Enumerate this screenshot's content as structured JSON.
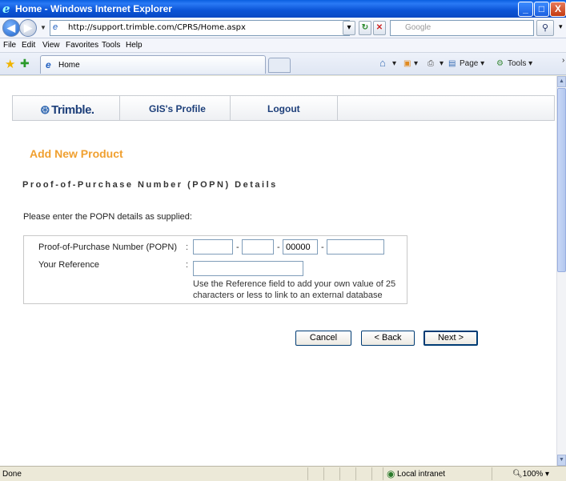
{
  "window": {
    "title": "Home - Windows Internet Explorer",
    "ie_logo": "e",
    "min_glyph": "_",
    "max_glyph": "□",
    "close_glyph": "X"
  },
  "address_bar": {
    "url": "http://support.trimble.com/CPRS/Home.aspx",
    "search_placeholder": "Google"
  },
  "menu": [
    "File",
    "Edit",
    "View",
    "Favorites",
    "Tools",
    "Help"
  ],
  "tabs": [
    {
      "label": "Home"
    }
  ],
  "command_bar": {
    "page_label": "Page ▾",
    "tools_label": "Tools ▾"
  },
  "site_nav": {
    "logo": "Trimble.",
    "links": [
      "GIS's Profile",
      "Logout"
    ]
  },
  "page": {
    "heading": "Add New Product",
    "subheading": "Proof-of-Purchase Number (POPN) Details",
    "intro": "Please enter the POPN details as supplied:"
  },
  "form": {
    "popn_label": "Proof-of-Purchase Number (POPN)",
    "popn_fields": [
      "",
      "",
      "00000",
      ""
    ],
    "reference_label": "Your Reference",
    "reference_value": "",
    "reference_hint": "Use the Reference field to add your own value of 25 characters or less to link to an external database"
  },
  "buttons": {
    "cancel": "Cancel",
    "back": "< Back",
    "next": "Next >"
  },
  "status_bar": {
    "status": "Done",
    "zone": "Local intranet",
    "zoom": "100%"
  },
  "colors": {
    "accent_heading": "#f0a030",
    "nav_text": "#1d3f7a",
    "titlebar": "#0a53d6"
  }
}
